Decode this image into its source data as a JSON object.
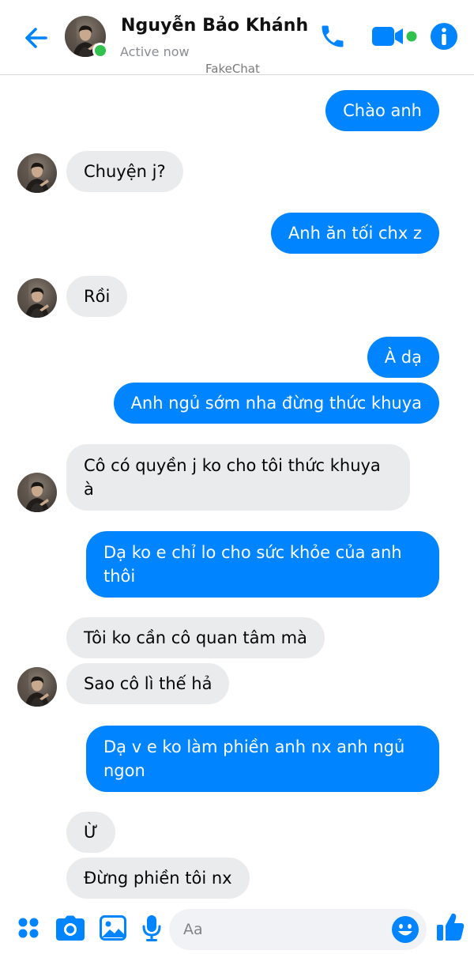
{
  "header": {
    "contact_name": "Nguyễn Bảo Khánh",
    "status": "Active now",
    "watermark": "FakeChat",
    "icons": {
      "back": "back-arrow-icon",
      "call": "phone-icon",
      "video": "video-camera-icon",
      "info": "info-icon"
    }
  },
  "colors": {
    "accent": "#0084ff",
    "incoming_bubble": "#eaebed",
    "online": "#31c24d"
  },
  "messages": [
    {
      "from": "me",
      "text": "Chào anh"
    },
    {
      "from": "contact",
      "text": "Chuyện j?"
    },
    {
      "from": "me",
      "text": "Anh ăn tối chx z"
    },
    {
      "from": "contact",
      "text": "Rồi"
    },
    {
      "from": "me",
      "text": "À dạ"
    },
    {
      "from": "me",
      "text": "Anh ngủ sớm nha đừng thức khuya"
    },
    {
      "from": "contact",
      "text": "Cô có quyền j ko cho tôi thức khuya à"
    },
    {
      "from": "me",
      "text": "Dạ ko e chỉ lo cho sức khỏe của anh thôi"
    },
    {
      "from": "contact",
      "text": "Tôi ko cần cô quan tâm mà"
    },
    {
      "from": "contact",
      "text": "Sao cô lì thế hả"
    },
    {
      "from": "me",
      "text": "Dạ v e ko làm phiền anh nx anh ngủ ngon"
    },
    {
      "from": "contact",
      "text": "Ừ"
    },
    {
      "from": "contact",
      "text": "Đừng phiền tôi nx"
    }
  ],
  "composer": {
    "placeholder": "Aa",
    "icons": [
      "menu-dots-icon",
      "camera-icon",
      "image-icon",
      "microphone-icon",
      "emoji-icon",
      "thumbs-up-icon"
    ]
  }
}
